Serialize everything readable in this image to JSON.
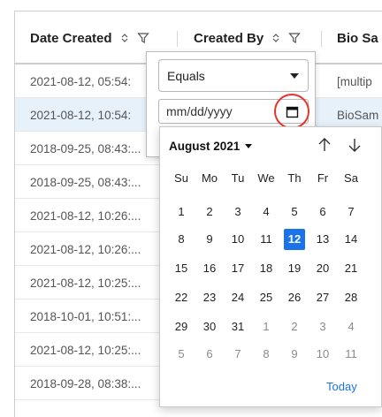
{
  "table": {
    "columns": [
      {
        "label": "Date Created"
      },
      {
        "label": "Created By"
      },
      {
        "label": "Bio Sa"
      }
    ],
    "rows": [
      {
        "date": "2021-08-12, 05:54:",
        "bio": "[multip"
      },
      {
        "date": "2021-08-12, 10:54:",
        "bio": "BioSam"
      },
      {
        "date": "2018-09-25, 08:43:...",
        "bio": ""
      },
      {
        "date": "2018-09-25, 08:43:...",
        "bio": ""
      },
      {
        "date": "2021-08-12, 10:26:...",
        "bio": ""
      },
      {
        "date": "2021-08-12, 10:26:...",
        "bio": ""
      },
      {
        "date": "2021-08-12, 10:25:...",
        "bio": ""
      },
      {
        "date": "2018-10-01, 10:51:...",
        "bio": ""
      },
      {
        "date": "2021-08-12, 10:25:...",
        "bio": ""
      },
      {
        "date": "2018-09-28, 08:38:...",
        "bio": ""
      }
    ]
  },
  "filter": {
    "operator": "Equals",
    "date_placeholder": "mm/dd/yyyy"
  },
  "datepicker": {
    "month_label": "August 2021",
    "weekdays": [
      "Su",
      "Mo",
      "Tu",
      "We",
      "Th",
      "Fr",
      "Sa"
    ],
    "weeks": [
      [
        "1",
        "2",
        "3",
        "4",
        "5",
        "6",
        "7"
      ],
      [
        "8",
        "9",
        "10",
        "11",
        "12",
        "13",
        "14"
      ],
      [
        "15",
        "16",
        "17",
        "18",
        "19",
        "20",
        "21"
      ],
      [
        "22",
        "23",
        "24",
        "25",
        "26",
        "27",
        "28"
      ],
      [
        "29",
        "30",
        "31",
        "1",
        "2",
        "3",
        "4"
      ],
      [
        "5",
        "6",
        "7",
        "8",
        "9",
        "10",
        "11"
      ]
    ],
    "selected": "12",
    "today_label": "Today"
  },
  "colors": {
    "accent": "#1a73e8",
    "highlight_ring": "#e5342c",
    "selected_row": "#e7f1fa"
  }
}
